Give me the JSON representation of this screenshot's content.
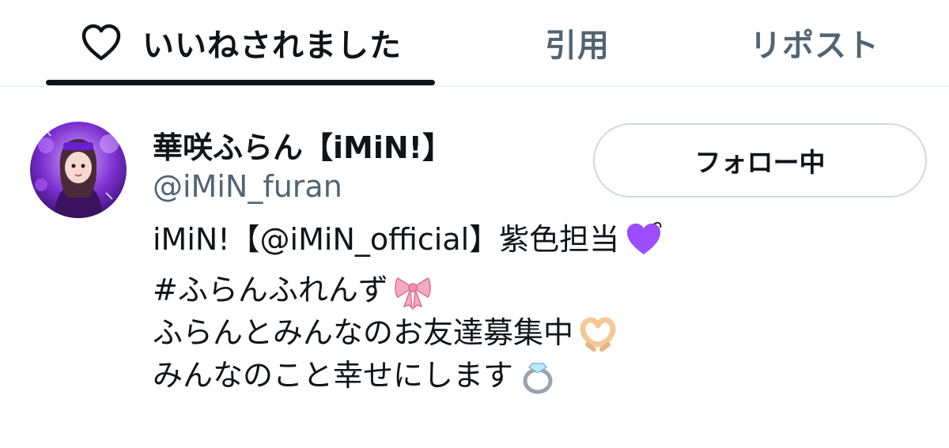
{
  "tabs": [
    {
      "label": "いいねされました",
      "icon": "heart-outline-icon",
      "active": true
    },
    {
      "label": "引用",
      "active": false
    },
    {
      "label": "リポスト",
      "active": false
    }
  ],
  "user": {
    "display_name": "華咲ふらん【iMiN!】",
    "handle": "@iMiN_furan",
    "follow_button": "フォロー中",
    "bio": [
      {
        "text": "iMiN!【@iMiN_official】紫色担当",
        "emoji": "purple-heart-icon"
      },
      {
        "text": "#ふらんふれんず",
        "emoji": "ribbon-icon"
      },
      {
        "text": "ふらんとみんなのお友達募集中",
        "emoji": "heart-hands-icon"
      },
      {
        "text": "みんなのこと幸せにします",
        "emoji": "ring-icon"
      }
    ]
  },
  "colors": {
    "text_primary": "#0f1419",
    "text_secondary": "#536471",
    "border": "#cfd9de",
    "divider": "#eff3f4"
  }
}
